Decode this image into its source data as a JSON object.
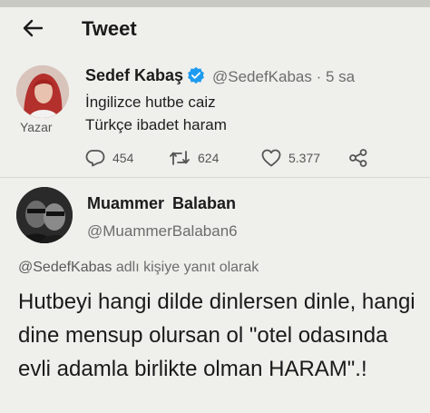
{
  "header": {
    "title": "Tweet",
    "back_icon": "arrow-left-icon"
  },
  "original_tweet": {
    "author_name": "Sedef Kabaş",
    "author_handle": "@SedefKabas · 5 sa",
    "avatar_caption": "Yazar",
    "verified_icon": "verified-badge-icon",
    "lines": [
      "İngilizce hutbe caiz",
      "Türkçe ibadet haram"
    ],
    "actions": {
      "replies": "454",
      "retweets": "624",
      "likes": "5.377"
    }
  },
  "reply_tweet": {
    "author_name": "Muammer Balaban",
    "author_handle": "@MuammerBalaban6",
    "reply_to_handle": "@SedefKabas",
    "reply_to_suffix": " adlı kişiye yanıt olarak",
    "text": "Hutbeyi hangi dilde dinlersen dinle, hangi dine mensup olursan ol \"otel odasında evli adamla birlikte olman HARAM\".!"
  },
  "colors": {
    "background": "#efefeb",
    "verified": "#1d9bf0"
  }
}
